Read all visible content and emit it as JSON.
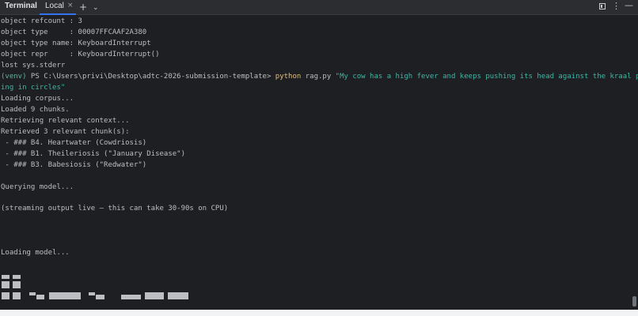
{
  "tabbar": {
    "tool_title": "Terminal",
    "tab_label": "Local",
    "close_glyph": "×",
    "plus_glyph": "+",
    "chevron_glyph": "⌄",
    "more_glyph": "⋮",
    "minimize_glyph": "—",
    "icons": [
      "close-icon",
      "plus-icon",
      "chevron-down-icon",
      "layout-icon",
      "more-icon",
      "minimize-icon"
    ]
  },
  "terminal": {
    "lines": {
      "l1": "object refcount : 3",
      "l2": "object type     : 00007FFCAAF2A380",
      "l3": "object type name: KeyboardInterrupt",
      "l4": "object repr     : KeyboardInterrupt()",
      "l5": "lost sys.stderr",
      "l6_venv": "(venv)",
      "l6_prompt": " PS C:\\Users\\privi\\Desktop\\adtc-2026-submission-template> ",
      "l6_cmd": "python",
      "l6_arg": " rag.py ",
      "l6_str": "\"My cow has a high fever and keeps pushing its head against the kraal post, walk",
      "l7_str": "ing in circles\"",
      "l8": "Loading corpus...",
      "l9": "Loaded 9 chunks.",
      "l10": "Retrieving relevant context...",
      "l11": "Retrieved 3 relevant chunk(s):",
      "l12": " - ### B4. Heartwater (Cowdriosis)",
      "l13": " - ### B1. Theileriosis (\"January Disease\")",
      "l14": " - ### B3. Babesiosis (\"Redwater\")",
      "l15": "Querying model...",
      "l16": "(streaming output live — this can take 30-90s on CPU)",
      "l17": "Loading model..."
    }
  },
  "colors": {
    "background": "#1e1f22",
    "tabbar": "#2b2d30",
    "accent": "#3574f0",
    "text": "#bcbec4",
    "venv_green": "#5fb3a1",
    "command_yellow": "#e5c07b",
    "string_teal": "#3fb6a8"
  }
}
